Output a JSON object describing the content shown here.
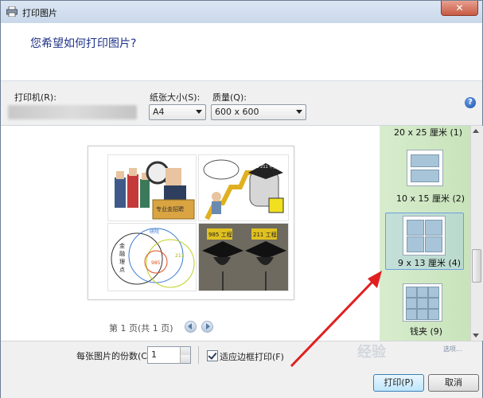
{
  "window": {
    "title": "打印图片",
    "close_label": "✕"
  },
  "header": {
    "heading": "您希望如何打印图片?"
  },
  "options": {
    "printer_label": "打印机(R):",
    "paper_label": "纸张大小(S):",
    "paper_value": "A4",
    "quality_label": "质量(Q):",
    "quality_value": "600 x 600",
    "help_label": "?"
  },
  "preview": {
    "page_info": "第 1 页(共 1 页)",
    "pictures": [
      {
        "name": "picture-officials-magnifier",
        "texts": [
          "专业金招聘"
        ]
      },
      {
        "name": "picture-graduate-cartoon",
        "texts": [
          "985 211 毕业"
        ]
      },
      {
        "name": "picture-venn-diagram",
        "texts": [
          "金",
          "融",
          "理",
          "点",
          "985",
          "211",
          "研院"
        ]
      },
      {
        "name": "picture-graduation-caps",
        "texts": [
          "985 工程",
          "211 工程"
        ]
      }
    ]
  },
  "layouts": [
    {
      "label": "20 x 25 厘米 (1)"
    },
    {
      "label": "10 x 15 厘米 (2)"
    },
    {
      "label": "9 x 13 厘米 (4)"
    },
    {
      "label": "钱夹 (9)"
    }
  ],
  "bottom": {
    "copies_label": "每张图片的份数(C):",
    "copies_value": "1",
    "fit_label": "适应边框打印(F)",
    "print_label": "打印(P)",
    "cancel_label": "取消"
  },
  "watermark": {
    "line1": "选项..."
  },
  "colors": {
    "heading": "#1e3287",
    "sidebar": "#d0e8c4",
    "selection": "#6aa0e0",
    "annotation_arrow": "#e02020"
  }
}
